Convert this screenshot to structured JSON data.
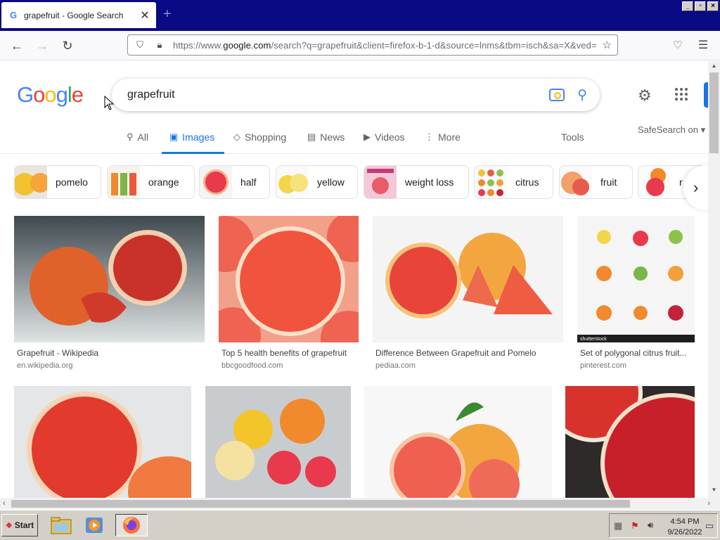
{
  "browser": {
    "tab_title": "grapefruit - Google Search",
    "tab_favicon": "G",
    "url_prefix": "https://www.",
    "url_domain": "google.com",
    "url_rest": "/search?q=grapefruit&client=firefox-b-1-d&source=lnms&tbm=isch&sa=X&ved="
  },
  "google": {
    "logo": [
      "G",
      "o",
      "o",
      "g",
      "l",
      "e"
    ],
    "logo_colors": [
      "#4285f4",
      "#ea4335",
      "#fbbc05",
      "#4285f4",
      "#34a853",
      "#ea4335"
    ],
    "query": "grapefruit"
  },
  "tabs": [
    {
      "label": "All",
      "icon": "search-icon"
    },
    {
      "label": "Images",
      "icon": "image-icon"
    },
    {
      "label": "Shopping",
      "icon": "tag-icon"
    },
    {
      "label": "News",
      "icon": "news-icon"
    },
    {
      "label": "Videos",
      "icon": "play-icon"
    },
    {
      "label": "More",
      "icon": "more-vert-icon"
    }
  ],
  "tools_label": "Tools",
  "safesearch_label": "SafeSearch on",
  "chips": [
    {
      "label": "pomelo"
    },
    {
      "label": "orange"
    },
    {
      "label": "half"
    },
    {
      "label": "yellow"
    },
    {
      "label": "weight loss"
    },
    {
      "label": "citrus"
    },
    {
      "label": "fruit"
    },
    {
      "label": "r"
    }
  ],
  "results": [
    {
      "caption": "Grapefruit - Wikipedia",
      "source": "en.wikipedia.org"
    },
    {
      "caption": "Top 5 health benefits of grapefruit",
      "source": "bbcgoodfood.com"
    },
    {
      "caption": "Difference Between Grapefruit and Pomelo",
      "source": "pediaa.com"
    },
    {
      "caption": "Set of polygonal citrus fruit...",
      "source": "pinterest.com"
    }
  ],
  "image_watermark": "shutterstock",
  "taskbar": {
    "start_label": "Start",
    "time": "4:54 PM",
    "date": "9/26/2022"
  },
  "accent": "#1a73e8"
}
